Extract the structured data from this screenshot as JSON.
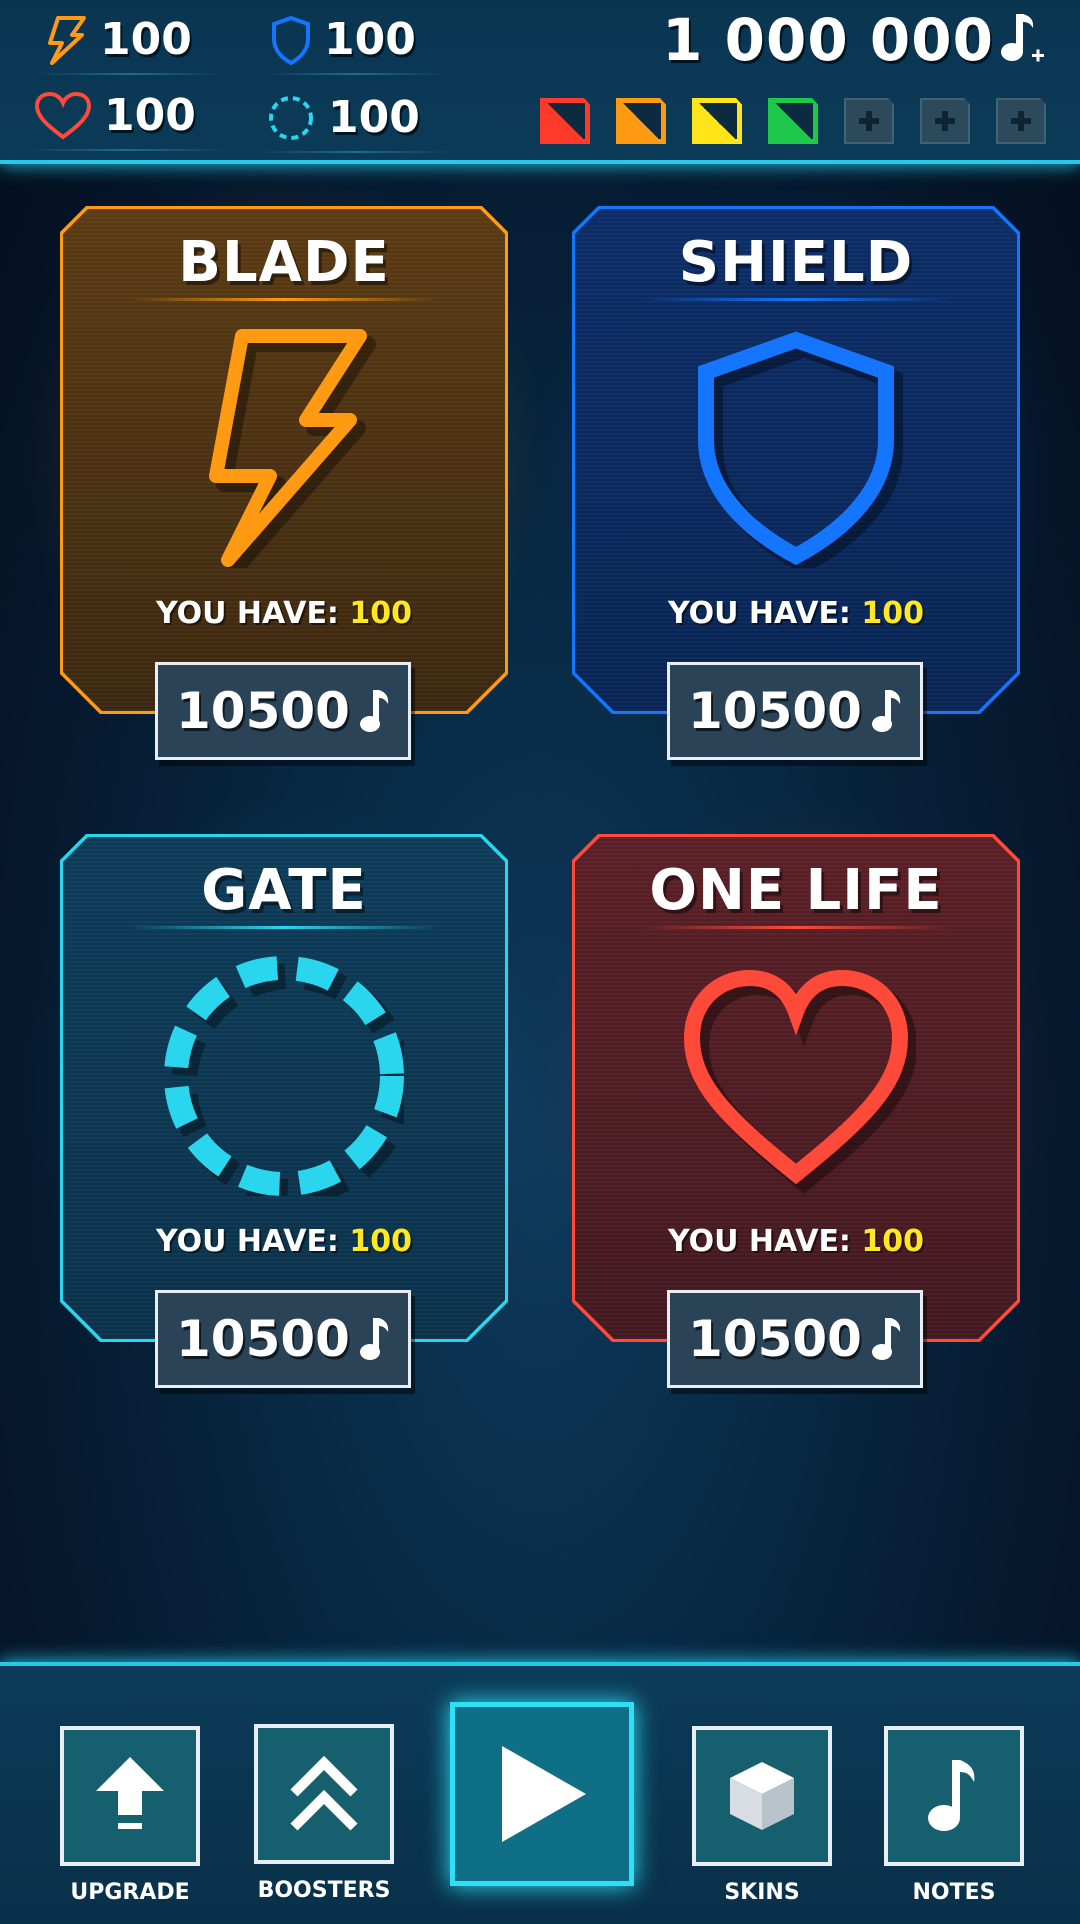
{
  "stats": {
    "blade": "100",
    "shield": "100",
    "one_life": "100",
    "gate": "100"
  },
  "balance": "1 000 000",
  "skin_slots": {
    "colors": [
      "#ff3a2a",
      "#ff9a12",
      "#ffe41a",
      "#1ec84a"
    ],
    "empty_count": 3
  },
  "cards": [
    {
      "title": "BLADE",
      "have_label": "YOU HAVE:",
      "have_value": "100",
      "price": "10500",
      "border": "#ff9a12",
      "icon": "lightning-icon"
    },
    {
      "title": "SHIELD",
      "have_label": "YOU HAVE:",
      "have_value": "100",
      "price": "10500",
      "border": "#1476ff",
      "icon": "shield-icon"
    },
    {
      "title": "GATE",
      "have_label": "YOU HAVE:",
      "have_value": "100",
      "price": "10500",
      "border": "#2ad6ee",
      "icon": "dashed-ring-icon"
    },
    {
      "title": "ONE LIFE",
      "have_label": "YOU HAVE:",
      "have_value": "100",
      "price": "10500",
      "border": "#ff4a3a",
      "icon": "heart-icon"
    }
  ],
  "nav": {
    "upgrade": "UPGRADE",
    "boosters": "BOOSTERS",
    "skins": "SKINS",
    "notes": "NOTES"
  }
}
